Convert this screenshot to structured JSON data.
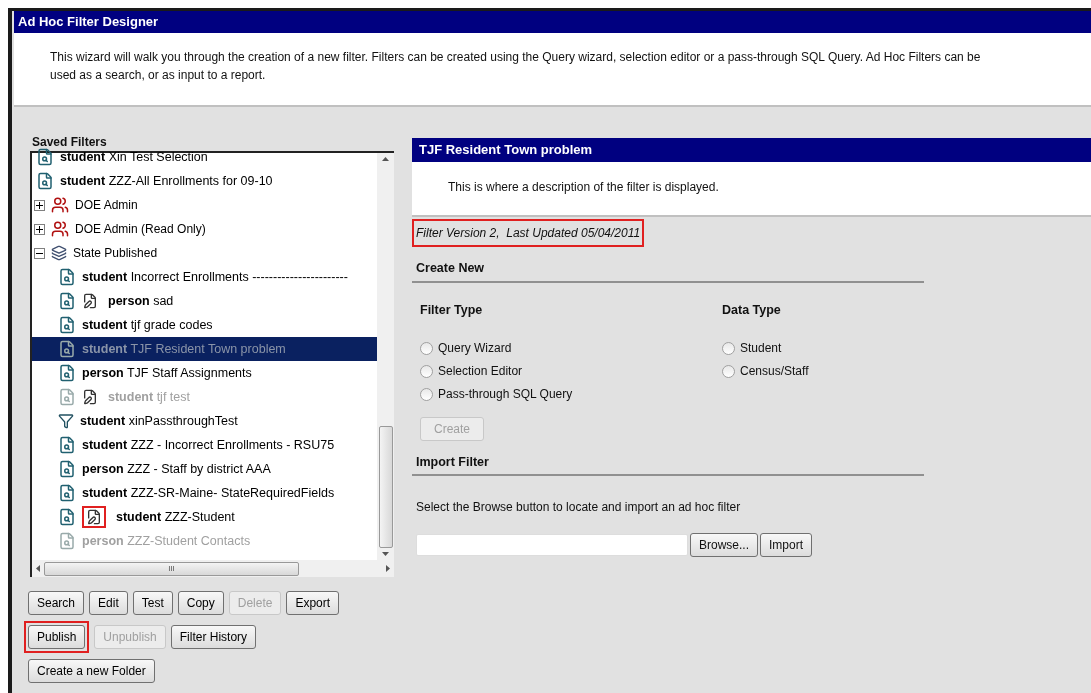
{
  "window": {
    "title": "Ad Hoc Filter Designer"
  },
  "intro": "This wizard will walk you through the creation of a new filter. Filters can be created using the Query wizard, selection editor or a pass-through SQL Query. Ad Hoc Filters can be used as a search, or as input to a report.",
  "saved_filters": {
    "label": "Saved Filters",
    "items": [
      {
        "kind": "query",
        "type": "student",
        "name": "Xin Test Selection",
        "edited": false,
        "disabled": false,
        "selected": false
      },
      {
        "kind": "query",
        "type": "student",
        "name": "ZZZ-All Enrollments for 09-10",
        "edited": false,
        "disabled": false,
        "selected": false
      },
      {
        "kind": "group",
        "name": "DOE Admin",
        "expanded": false,
        "selected": false
      },
      {
        "kind": "group",
        "name": "DOE Admin (Read Only)",
        "expanded": false,
        "selected": false
      },
      {
        "kind": "folder",
        "name": "State Published",
        "expanded": true,
        "selected": false,
        "children": [
          {
            "kind": "query",
            "type": "student",
            "name": "Incorrect Enrollments -----------------------",
            "edited": false,
            "disabled": false,
            "selected": false
          },
          {
            "kind": "query",
            "type": "person",
            "name": "sad",
            "edited": true,
            "disabled": false,
            "selected": false
          },
          {
            "kind": "query",
            "type": "student",
            "name": "tjf grade codes",
            "edited": false,
            "disabled": false,
            "selected": false
          },
          {
            "kind": "query",
            "type": "student",
            "name": "TJF Resident Town problem",
            "edited": false,
            "disabled": false,
            "selected": true
          },
          {
            "kind": "query",
            "type": "person",
            "name": "TJF Staff Assignments",
            "edited": false,
            "disabled": false,
            "selected": false
          },
          {
            "kind": "query",
            "type": "student",
            "name": "tjf test",
            "edited": true,
            "disabled": true,
            "selected": false
          },
          {
            "kind": "passthrough",
            "type": "student",
            "name": "xinPassthroughTest",
            "edited": false,
            "disabled": false,
            "selected": false
          },
          {
            "kind": "query",
            "type": "student",
            "name": "ZZZ - Incorrect Enrollments - RSU75",
            "edited": false,
            "disabled": false,
            "selected": false
          },
          {
            "kind": "query",
            "type": "person",
            "name": "ZZZ - Staff by district AAA",
            "edited": false,
            "disabled": false,
            "selected": false
          },
          {
            "kind": "query",
            "type": "student",
            "name": "ZZZ-SR-Maine- StateRequiredFields",
            "edited": false,
            "disabled": false,
            "selected": false
          },
          {
            "kind": "query",
            "type": "student",
            "name": "ZZZ-Student",
            "edited": true,
            "disabled": false,
            "selected": false,
            "highlighted": true
          },
          {
            "kind": "query",
            "type": "person",
            "name": "ZZZ-Student Contacts",
            "edited": false,
            "disabled": true,
            "selected": false
          }
        ]
      }
    ],
    "scroll_grip": "III"
  },
  "button_rows": [
    [
      {
        "label": "Search",
        "disabled": false,
        "highlighted": false
      },
      {
        "label": "Edit",
        "disabled": false,
        "highlighted": false
      },
      {
        "label": "Test",
        "disabled": false,
        "highlighted": false
      },
      {
        "label": "Copy",
        "disabled": false,
        "highlighted": false
      },
      {
        "label": "Delete",
        "disabled": true,
        "highlighted": false
      },
      {
        "label": "Export",
        "disabled": false,
        "highlighted": false
      }
    ],
    [
      {
        "label": "Publish",
        "disabled": false,
        "highlighted": true
      },
      {
        "label": "Unpublish",
        "disabled": true,
        "highlighted": false
      },
      {
        "label": "Filter History",
        "disabled": false,
        "highlighted": false
      }
    ],
    [
      {
        "label": "Create a new Folder",
        "disabled": false,
        "highlighted": false
      }
    ]
  ],
  "detail": {
    "title": "TJF Resident Town problem",
    "description": "This is where a description of the filter is displayed.",
    "version": {
      "text": "Filter Version 2,  Last Updated 05/04/2011",
      "highlighted": true
    }
  },
  "create_new": {
    "heading": "Create New",
    "filter_type": {
      "label": "Filter Type",
      "options": [
        {
          "label": "Query Wizard",
          "selected": false
        },
        {
          "label": "Selection Editor",
          "selected": false
        },
        {
          "label": "Pass-through SQL Query",
          "selected": false
        }
      ]
    },
    "data_type": {
      "label": "Data Type",
      "options": [
        {
          "label": "Student",
          "selected": false
        },
        {
          "label": "Census/Staff",
          "selected": false
        }
      ]
    },
    "button": {
      "label": "Create",
      "disabled": true
    }
  },
  "import_filter": {
    "heading": "Import Filter",
    "instructions": "Select the Browse button to locate and import an ad hoc filter",
    "browse": "Browse...",
    "import": "Import"
  }
}
